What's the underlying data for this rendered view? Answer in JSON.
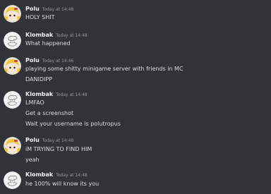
{
  "colors": {
    "background": "#313338",
    "username": "#f2f3f5",
    "timestamp": "#949ba4",
    "message_text": "#dbdee1"
  },
  "messages": [
    {
      "author": "Polu",
      "avatar": "polu-avatar-icon",
      "timestamp": "Today at 14:48",
      "lines": [
        "HOLY SHIT"
      ]
    },
    {
      "author": "Klombak",
      "avatar": "klombak-avatar-icon",
      "timestamp": "Today at 14:48",
      "lines": [
        "What happened"
      ]
    },
    {
      "author": "Polu",
      "avatar": "polu-avatar-icon",
      "timestamp": "Today at 14:46",
      "lines": [
        "playing some shitty minigame server with friends in MC",
        "DANIDIPP"
      ]
    },
    {
      "author": "Klombak",
      "avatar": "klombak-avatar-icon",
      "timestamp": "Today at 14:48",
      "lines": [
        "LMFAO",
        "Get a screenshot",
        "Wait your username is polutropus"
      ]
    },
    {
      "author": "Polu",
      "avatar": "polu-avatar-icon",
      "timestamp": "Today at 14:48",
      "lines": [
        "iM TRYING TO FIND HIM",
        "yeah"
      ]
    },
    {
      "author": "Klombak",
      "avatar": "klombak-avatar-icon",
      "timestamp": "Today at 14:48",
      "lines": [
        "he 100% will know its you"
      ]
    }
  ]
}
